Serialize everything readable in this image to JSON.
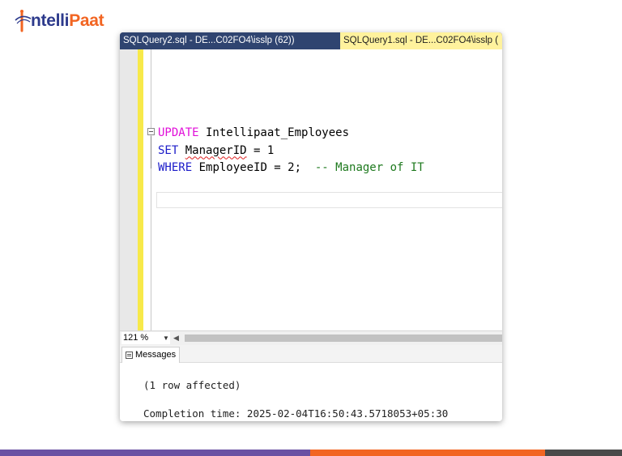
{
  "logo": {
    "text_main": "ntelli",
    "text_accent": "Paat",
    "colors": {
      "main": "#2d3a8c",
      "accent": "#f26522"
    }
  },
  "tabs": [
    {
      "label": "SQLQuery2.sql - DE...C02FO4\\isslp (62))",
      "active": false
    },
    {
      "label": "SQLQuery1.sql - DE...C02FO4\\isslp (",
      "active": true
    }
  ],
  "code": {
    "line1": {
      "keyword": "UPDATE",
      "rest": " Intellipaat_Employees"
    },
    "line2": {
      "keyword": "SET",
      "ident": "ManagerID",
      "rest": " = 1"
    },
    "line3": {
      "keyword": "WHERE",
      "rest": " EmployeeID = 2;  ",
      "comment": "-- Manager of IT"
    }
  },
  "status": {
    "zoom": "121 %"
  },
  "results": {
    "tab_label": "Messages",
    "line1": "(1 row affected)",
    "line2": "Completion time: 2025-02-04T16:50:43.5718053+05:30"
  },
  "colors": {
    "keyword_pink": "#e10fd9",
    "keyword_blue": "#1c1cc9",
    "comment": "#1f7a1f",
    "tab_active": "#fff29d",
    "tab_inactive": "#2f4470",
    "footer_purple": "#6a51a3",
    "footer_orange": "#f26522",
    "footer_gray": "#4a4a4a"
  }
}
